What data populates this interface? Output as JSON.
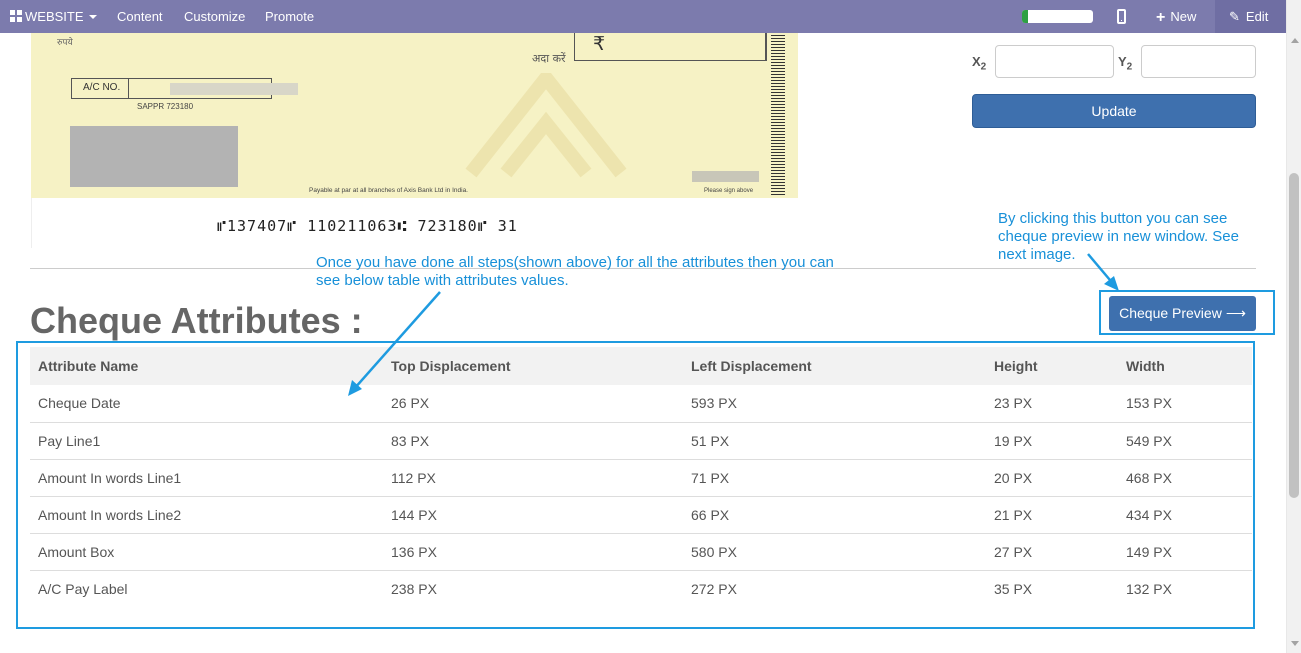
{
  "topbar": {
    "website_label": "WEBSITE",
    "menu": [
      "Content",
      "Customize",
      "Promote"
    ],
    "progress_fraction": 0.08,
    "new_label": "New",
    "edit_label": "Edit"
  },
  "cheque": {
    "rupees_text": "रुपये",
    "ada_text": "अदा करें",
    "rupee_symbol": "₹",
    "ac_label": "A/C NO.",
    "sappr_text": "SAPPR      723180",
    "payable_text": "Payable at par at all branches of Axis Bank Ltd in India.",
    "sign_text": "Please sign above",
    "micr": "⑈137407⑈ 110211063⑆ 723180⑈ 31"
  },
  "form": {
    "x2_label": "X",
    "x2_sub": "2",
    "y2_label": "Y",
    "y2_sub": "2",
    "x2_value": "",
    "y2_value": "",
    "update_label": "Update"
  },
  "annotations": {
    "preview_note": "By clicking this button you can see cheque preview in new window. See next image.",
    "table_note": "Once you have done all steps(shown above) for all the attributes then you can see below table with attributes values."
  },
  "preview_button": {
    "label": "Cheque Preview",
    "arrow": "⟶"
  },
  "heading": "Cheque Attributes :",
  "table": {
    "headers": [
      "Attribute Name",
      "Top Displacement",
      "Left Displacement",
      "Height",
      "Width"
    ],
    "rows": [
      [
        "Cheque Date",
        "26 PX",
        "593 PX",
        "23 PX",
        "153 PX"
      ],
      [
        "Pay Line1",
        "83 PX",
        "51 PX",
        "19 PX",
        "549 PX"
      ],
      [
        "Amount In words Line1",
        "112 PX",
        "71 PX",
        "20 PX",
        "468 PX"
      ],
      [
        "Amount In words Line2",
        "144 PX",
        "66 PX",
        "21 PX",
        "434 PX"
      ],
      [
        "Amount Box",
        "136 PX",
        "580 PX",
        "27 PX",
        "149 PX"
      ],
      [
        "A/C Pay Label",
        "238 PX",
        "272 PX",
        "35 PX",
        "132 PX"
      ]
    ]
  },
  "colors": {
    "topbar": "#7c7bad",
    "button": "#3e70ae",
    "annotation": "#1890d8"
  }
}
